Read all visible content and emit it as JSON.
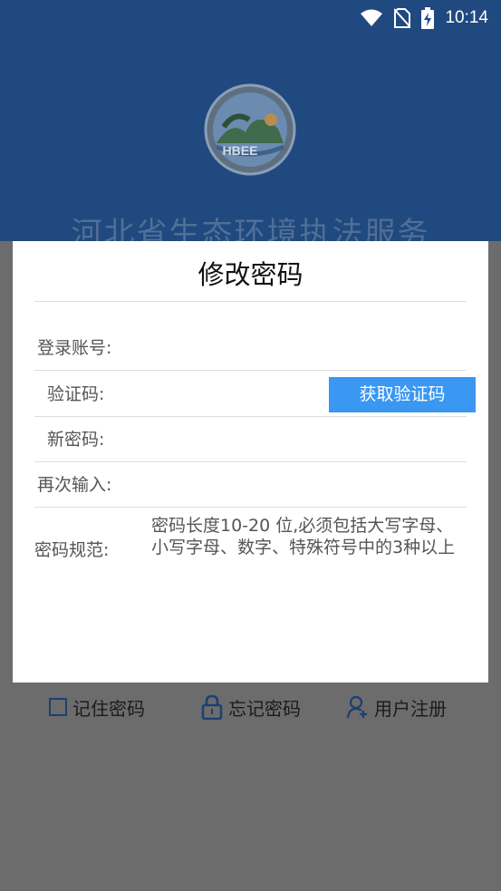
{
  "status_bar": {
    "time": "10:14",
    "icons": [
      "wifi-icon",
      "no-sim-icon",
      "battery-charging-icon"
    ]
  },
  "app": {
    "logo_text": "HBEE",
    "title": "河北省生态环境执法服务"
  },
  "bottom_links": {
    "remember": "记住密码",
    "forgot": "忘记密码",
    "register": "用户注册"
  },
  "dialog": {
    "title": "修改密码",
    "fields": {
      "account_label": "登录账号:",
      "code_label": "验证码:",
      "new_password_label": "新密码:",
      "confirm_label": "再次输入:",
      "rule_label": "密码规范:"
    },
    "get_code_button": "获取验证码",
    "rule_text": "密码长度10-20 位,必须包括大写字母、小写字母、数字、特殊符号中的3种以上"
  },
  "colors": {
    "header_blue": "#20497f",
    "button_blue": "#3a97f2",
    "overlay_gray": "#6c6c6c"
  }
}
